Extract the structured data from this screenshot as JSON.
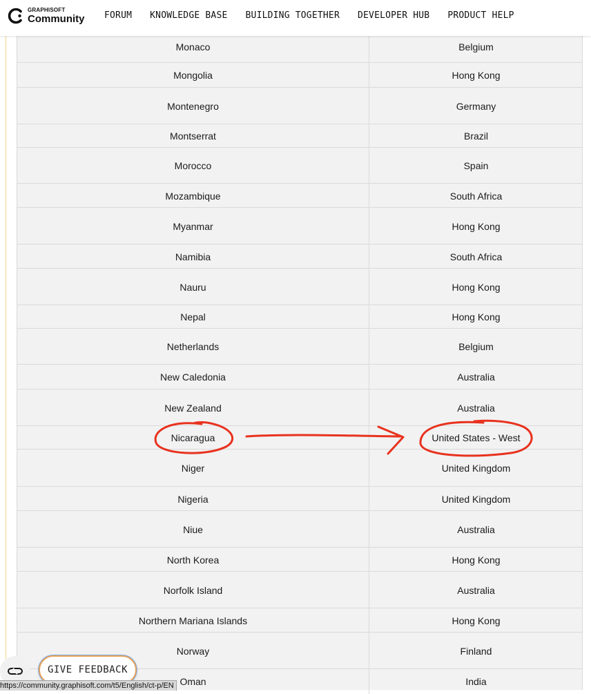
{
  "header": {
    "logo_small": "GRAPHISOFT",
    "logo_big": "Community",
    "nav": [
      "FORUM",
      "KNOWLEDGE BASE",
      "BUILDING TOGETHER",
      "DEVELOPER HUB",
      "PRODUCT HELP"
    ]
  },
  "table": {
    "rows": [
      {
        "country": "Monaco",
        "region": "Belgium"
      },
      {
        "country": "Mongolia",
        "region": "Hong Kong"
      },
      {
        "country": "Montenegro",
        "region": "Germany"
      },
      {
        "country": "Montserrat",
        "region": "Brazil"
      },
      {
        "country": "Morocco",
        "region": "Spain"
      },
      {
        "country": "Mozambique",
        "region": "South Africa"
      },
      {
        "country": "Myanmar",
        "region": "Hong Kong"
      },
      {
        "country": "Namibia",
        "region": "South Africa"
      },
      {
        "country": "Nauru",
        "region": "Hong Kong"
      },
      {
        "country": "Nepal",
        "region": "Hong Kong"
      },
      {
        "country": "Netherlands",
        "region": "Belgium"
      },
      {
        "country": "New Caledonia",
        "region": "Australia"
      },
      {
        "country": "New Zealand",
        "region": "Australia"
      },
      {
        "country": "Nicaragua",
        "region": "United States - West"
      },
      {
        "country": "Niger",
        "region": "United Kingdom"
      },
      {
        "country": "Nigeria",
        "region": "United Kingdom"
      },
      {
        "country": "Niue",
        "region": "Australia"
      },
      {
        "country": "North Korea",
        "region": "Hong Kong"
      },
      {
        "country": "Norfolk Island",
        "region": "Australia"
      },
      {
        "country": "Northern Mariana Islands",
        "region": "Hong Kong"
      },
      {
        "country": "Norway",
        "region": "Finland"
      },
      {
        "country": "Oman",
        "region": "India"
      }
    ]
  },
  "annotation": {
    "color": "#e8321e",
    "highlighted_row": "Nicaragua"
  },
  "widgets": {
    "feedback_label": "GIVE FEEDBACK",
    "status_url": "https://community.graphisoft.com/t5/English/ct-p/EN",
    "left_icon": "infinity-icon"
  }
}
